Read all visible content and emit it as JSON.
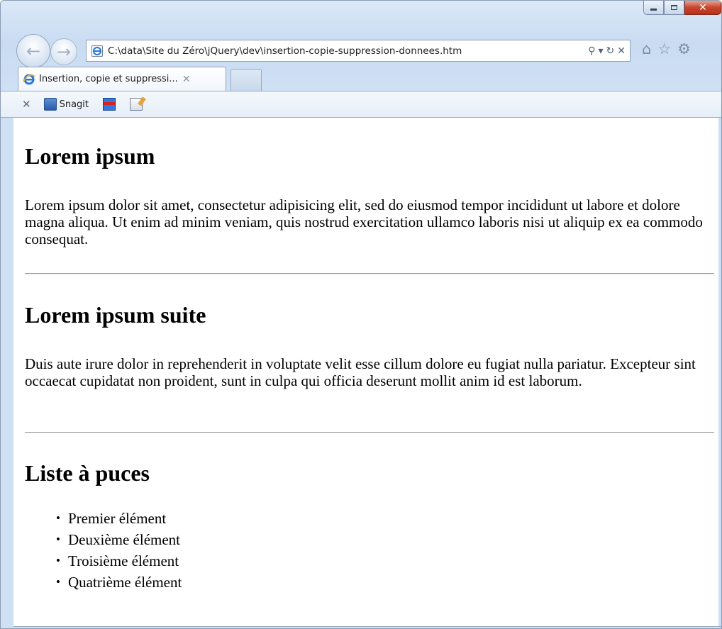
{
  "browser": {
    "address_url": "C:\\data\\Site du Zéro\\jQuery\\dev\\insertion-copie-suppression-donnees.htm",
    "search_glyph": "⚲",
    "dropdown_glyph": "▾",
    "refresh_glyph": "↻",
    "stop_glyph": "✕",
    "home_glyph": "⌂",
    "favorites_glyph": "☆",
    "tools_glyph": "⚙",
    "back_glyph": "←",
    "forward_glyph": "→",
    "tab": {
      "title": "Insertion, copie et suppressi...",
      "close_glyph": "✕"
    },
    "command_bar": {
      "close_glyph": "✕",
      "snagit_label": "Snagit"
    },
    "caption": {
      "close_glyph": "✕"
    },
    "accent_color": "#1e73d2"
  },
  "page": {
    "heading1": "Lorem ipsum",
    "paragraph1": "Lorem ipsum dolor sit amet, consectetur adipisicing elit, sed do eiusmod tempor incididunt ut labore et dolore magna aliqua. Ut enim ad minim veniam, quis nostrud exercitation ullamco laboris nisi ut aliquip ex ea commodo consequat.",
    "heading2": "Lorem ipsum suite",
    "paragraph2": "Duis aute irure dolor in reprehenderit in voluptate velit esse cillum dolore eu fugiat nulla pariatur. Excepteur sint occaecat cupidatat non proident, sunt in culpa qui officia deserunt mollit anim id est laborum.",
    "heading3": "Liste à puces",
    "list_items": [
      "Premier élément",
      "Deuxième élément",
      "Troisième élément",
      "Quatrième élément"
    ]
  }
}
